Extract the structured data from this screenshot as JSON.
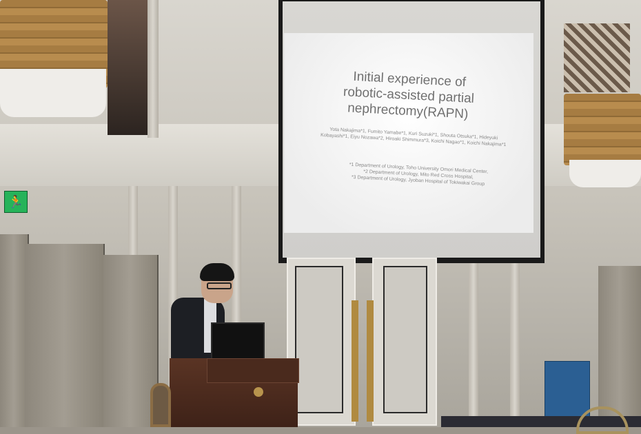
{
  "scene": {
    "type": "conference presentation photo"
  },
  "slide": {
    "title_line1": "Initial experience of",
    "title_line2": "robotic-assisted partial",
    "title_line3": "nephrectomy(RAPN)",
    "authors": "Yota Nakajima*1, Fumito Yamabe*1, Kuri Suzuki*1, Shouta Otsuka*1, Hideyuki Kobayashi*1, Eiyu Nozawa*2, Hiroaki Shimmura*3, Koichi Nagao*1, Koichi Nakajima*1",
    "affil1": "*1 Department of Urology, Toho University Omori Medical Center,",
    "affil2": "*2 Department of Urology, Mito Red Cross Hospital,",
    "affil3": "*3 Department of Urology, Jyoban Hospital of Tokiwakai Group"
  },
  "colors": {
    "exit_sign": "#26b35a",
    "podium": "#4a2a1d",
    "bin": "#2b5f93"
  }
}
